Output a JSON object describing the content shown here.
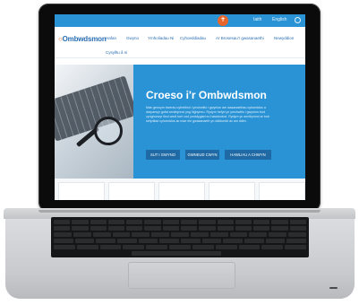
{
  "topbar": {
    "links": [
      "Iaith",
      "English"
    ],
    "search_icon": "search-icon",
    "seal_icon": "seal-icon",
    "seal_glyph": "✝"
  },
  "header": {
    "logo_text": "Ombwdsmon",
    "nav": [
      "Hafan",
      "Gwyno",
      "Ymholiadau Ni",
      "Cyhoeddiadau",
      "Ar Brosesau'r gwasanaethi",
      "Newyddion",
      "Cysylltu â ni"
    ]
  },
  "hero": {
    "title": "Croeso i'r Ombwdsmon",
    "body": "Mae gennym bwerau cyfreithiol i ymchwilio i gwynion am wasanaethau cyhoeddus a darparwyr gofal annibynnol yng Nghymru. Rydym hefyd yn ymchwilio i gwynion bod cynghorwyr lleol wedi torri cod ymddygiad eu hawdurdod. Rydym yn annibynnol ar bob sefydliad cyhoeddus ac mae ein gwasanaeth yn ddiduedd ac am ddim.",
    "buttons": [
      "SUT I GWYNO",
      "GWNEUD CWYN",
      "HAWLIAU A CHWYN"
    ]
  },
  "colors": {
    "brand_blue": "#2a93d5",
    "button_blue": "#1f6aa5",
    "accent_orange": "#e8662a"
  }
}
